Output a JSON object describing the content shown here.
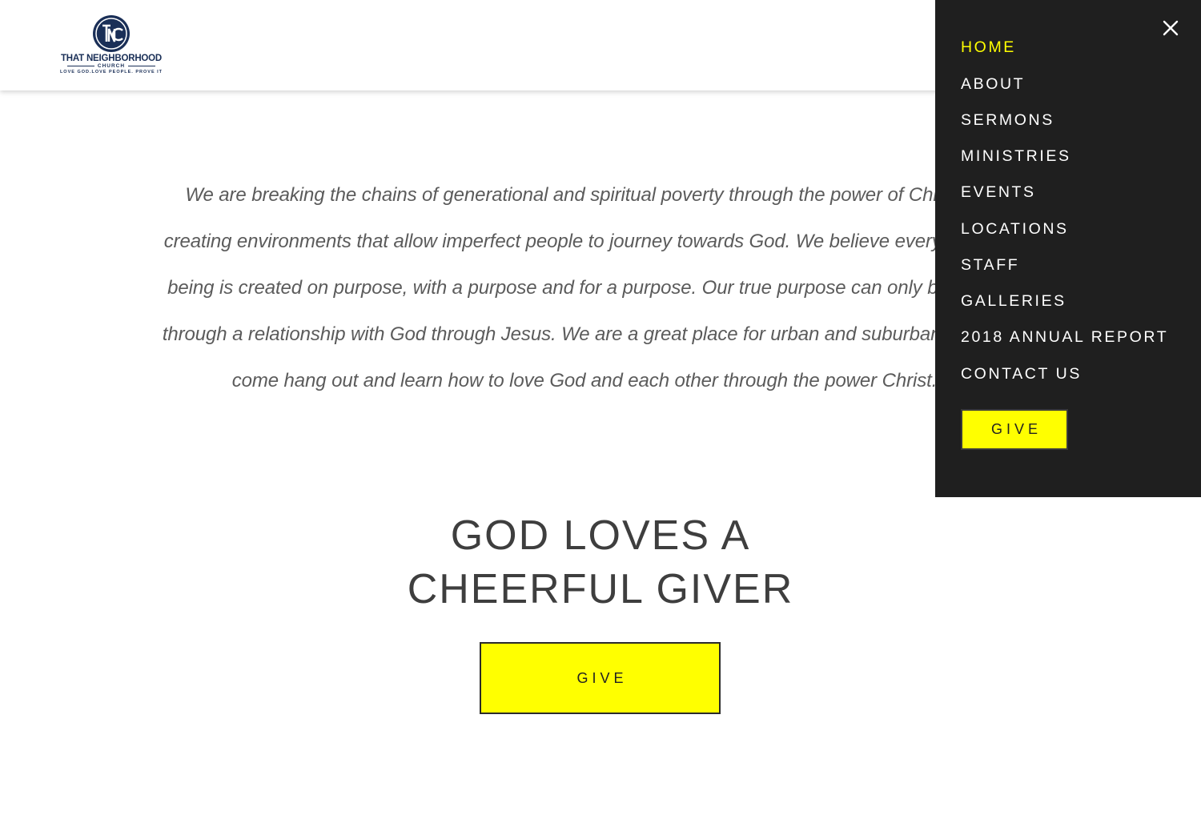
{
  "header": {
    "logo": {
      "monogram": "TNC",
      "name": "THAT NEIGHBORHOOD",
      "sub": "CHURCH",
      "tagline": "LOVE GOD.LOVE PEOPLE. PROVE IT",
      "color": "#1a2f57"
    }
  },
  "main": {
    "mission_lines": [
      "We are breaking the chains of generational and spiritual poverty through the power of Christ by",
      "creating environments that allow imperfect people to journey towards God.  We believe every human",
      "being is created on purpose, with a purpose and for a purpose.  Our true purpose can only be found",
      "through a relationship with God through Jesus.  We are a great place for urban and suburban folks to",
      "come hang out and learn how to love God and each other through the power Christ."
    ],
    "giver_heading": [
      "GOD LOVES A",
      "CHEERFUL GIVER"
    ],
    "give_button": "GIVE"
  },
  "nav": {
    "close_icon": "close-icon",
    "items": [
      {
        "label": "HOME",
        "active": true
      },
      {
        "label": "ABOUT",
        "active": false
      },
      {
        "label": "SERMONS",
        "active": false
      },
      {
        "label": "MINISTRIES",
        "active": false
      },
      {
        "label": "EVENTS",
        "active": false
      },
      {
        "label": "LOCATIONS",
        "active": false
      },
      {
        "label": "STAFF",
        "active": false
      },
      {
        "label": "GALLERIES",
        "active": false
      },
      {
        "label": "2018 ANNUAL REPORT",
        "active": false
      },
      {
        "label": "CONTACT US",
        "active": false
      }
    ],
    "give_button": "GIVE"
  },
  "colors": {
    "accent": "#ffff00",
    "panel": "#1f1f1f",
    "text_dark": "#3e3e3e",
    "mission_text": "#5b5b5b"
  }
}
